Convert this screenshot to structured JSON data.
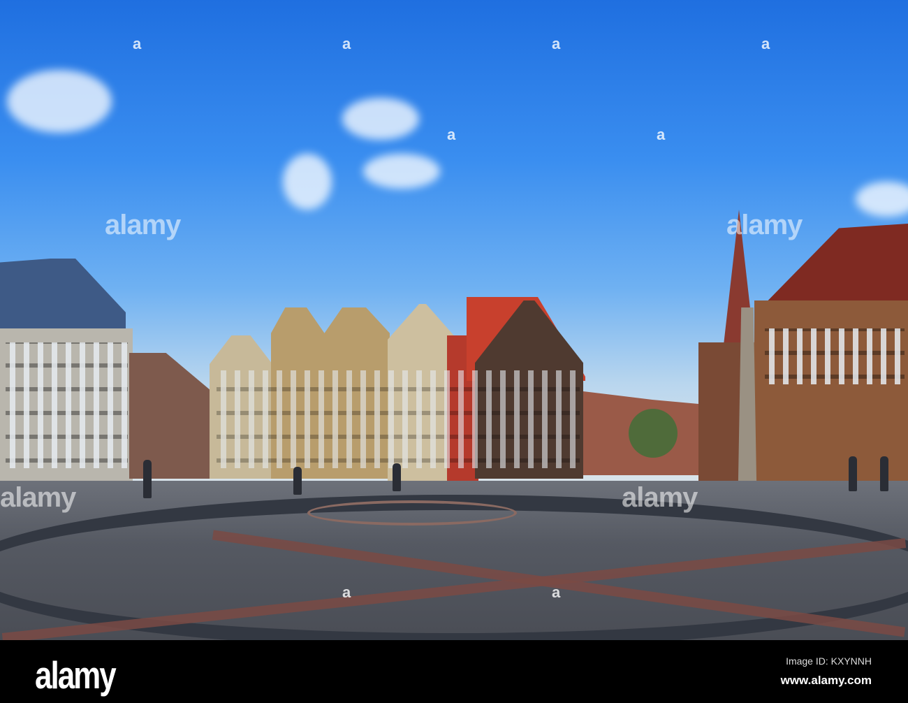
{
  "photo": {
    "subject": "Bremen market square"
  },
  "watermark": {
    "text": "alamy",
    "repeat_mark": "a"
  },
  "footer": {
    "logo": "alamy",
    "image_id": "Image ID: KXYNNH",
    "site": "www.alamy.com"
  }
}
